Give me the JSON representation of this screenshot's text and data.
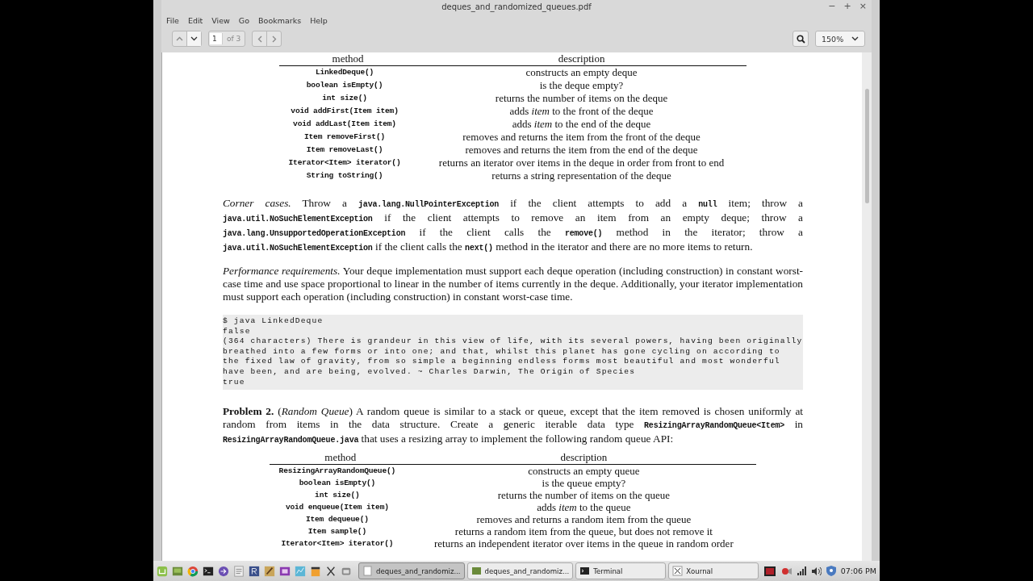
{
  "window": {
    "title": "deques_and_randomized_queues.pdf",
    "controls": [
      "−",
      "+",
      "×"
    ]
  },
  "menu": [
    "File",
    "Edit",
    "View",
    "Go",
    "Bookmarks",
    "Help"
  ],
  "toolbar": {
    "page_field": "1",
    "page_count": "of 3",
    "zoom": "150%"
  },
  "document": {
    "table_1": {
      "columns": [
        "method",
        "description"
      ],
      "rows": [
        {
          "method": "LinkedDeque()",
          "description": "constructs an empty deque"
        },
        {
          "method": "boolean isEmpty()",
          "description": "is the deque empty?"
        },
        {
          "method": "int size()",
          "description": "returns the number of items on the deque"
        },
        {
          "method": "void addFirst(Item item)",
          "description": "adds *item* to the front of the deque"
        },
        {
          "method": "void addLast(Item item)",
          "description": "adds *item* to the end of the deque"
        },
        {
          "method": "Item removeFirst()",
          "description": "removes and returns the item from the front of the deque"
        },
        {
          "method": "Item removeLast()",
          "description": "removes and returns the item from the end of the deque"
        },
        {
          "method": "Iterator<Item> iterator()",
          "description": "returns an iterator over items in the deque in order from front to end"
        },
        {
          "method": "String toString()",
          "description": "returns a string representation of the deque"
        }
      ]
    },
    "corner_cases": [
      {
        "kind": "italic",
        "text": "Corner cases."
      },
      {
        "kind": "roman",
        "text": " Throw a "
      },
      {
        "kind": "code",
        "text": "java.lang.NullPointerException"
      },
      {
        "kind": "roman",
        "text": " if the client attempts to add a "
      },
      {
        "kind": "code",
        "text": "null"
      },
      {
        "kind": "roman",
        "text": " item; throw a "
      },
      {
        "kind": "code",
        "text": "java.util.NoSuchElementException"
      },
      {
        "kind": "roman",
        "text": " if the client attempts to remove an item from an empty deque; throw a "
      },
      {
        "kind": "code",
        "text": "java.lang.UnsupportedOperationException"
      },
      {
        "kind": "roman",
        "text": " if the client calls the "
      },
      {
        "kind": "code",
        "text": "remove()"
      },
      {
        "kind": "roman",
        "text": " method in the iterator; throw a "
      },
      {
        "kind": "code",
        "text": "java.util.NoSuchElementException"
      },
      {
        "kind": "roman",
        "text": " if the client calls the "
      },
      {
        "kind": "code",
        "text": "next()"
      },
      {
        "kind": "roman",
        "text": " method in the iterator and there are no more items to return."
      }
    ],
    "performance": [
      {
        "kind": "italic",
        "text": "Performance requirements."
      },
      {
        "kind": "roman",
        "text": "  Your deque implementation must support each deque operation (including construction) in constant worst-case time and use space proportional to linear in the number of items currently in the deque.  Additionally, your iterator implementation must support each operation (including construction) in constant worst-case time."
      }
    ],
    "console_output": [
      "$ java LinkedDeque",
      "false",
      "(364 characters) There is grandeur in this view of life, with its several powers, having been originally",
      "breathed into a few forms or into one; and that, whilst this planet has gone cycling on according to",
      "the fixed law of gravity, from so simple a beginning endless forms most beautiful and most wonderful",
      "have been, and are being, evolved. ~ Charles Darwin, The Origin of Species",
      "true"
    ],
    "problem_2": [
      {
        "kind": "bold",
        "text": "Problem 2."
      },
      {
        "kind": "roman",
        "text": " ("
      },
      {
        "kind": "italic",
        "text": "Random Queue"
      },
      {
        "kind": "roman",
        "text": ") A random queue is similar to a stack or queue, except that the item removed is chosen uniformly at random from items in the data structure. Create a generic iterable data type "
      },
      {
        "kind": "code",
        "text": "ResizingArrayRandomQueue<Item>"
      },
      {
        "kind": "roman",
        "text": " in "
      },
      {
        "kind": "code",
        "text": "ResizingArrayRandomQueue.java"
      },
      {
        "kind": "roman",
        "text": " that uses a resizing array to implement the following random queue API:"
      }
    ],
    "table_2": {
      "columns": [
        "method",
        "description"
      ],
      "rows": [
        {
          "method": "ResizingArrayRandomQueue()",
          "description": "constructs an empty queue"
        },
        {
          "method": "boolean isEmpty()",
          "description": "is the queue empty?"
        },
        {
          "method": "int size()",
          "description": "returns the number of items on the queue"
        },
        {
          "method": "void enqueue(Item item)",
          "description": "adds *item* to the queue"
        },
        {
          "method": "Item dequeue()",
          "description": "removes and returns a random item from the queue"
        },
        {
          "method": "Item sample()",
          "description": "returns a random item from the queue, but does not remove it"
        },
        {
          "method": "Iterator<Item> iterator()",
          "description": "returns an independent iterator over items in the queue in random order"
        }
      ]
    }
  },
  "taskbar": {
    "windows": [
      {
        "label": "deques_and_randomiz...",
        "kind": "document",
        "selected": true
      },
      {
        "label": "deques_and_randomiz...",
        "kind": "viewer",
        "selected": false
      },
      {
        "label": "Terminal",
        "kind": "terminal",
        "selected": false
      },
      {
        "label": "Xournal",
        "kind": "xournal",
        "selected": false
      }
    ],
    "clock": "07:06 PM"
  }
}
